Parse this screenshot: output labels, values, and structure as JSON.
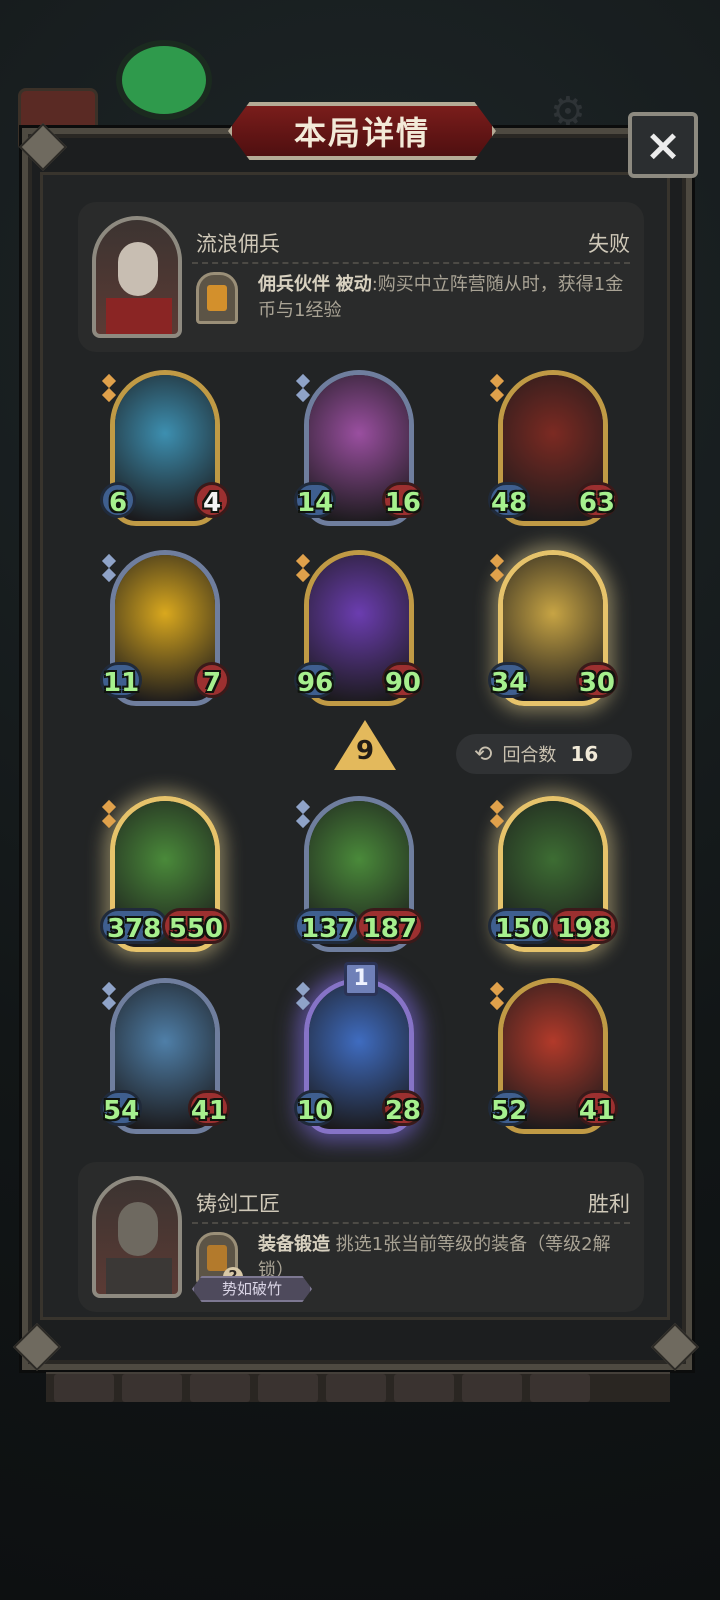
{
  "dialog": {
    "title": "本局详情",
    "close_icon": "×"
  },
  "opponent_top": {
    "name": "流浪佣兵",
    "result": "失败",
    "skill_name": "佣兵伙伴",
    "skill_type": "被动",
    "skill_desc": ":购买中立阵营随从时，获得1金币与1经验"
  },
  "opponent_bottom": {
    "name": "铸剑工匠",
    "result": "胜利",
    "skill_name": "装备锻造",
    "skill_desc": "挑选1张当前等级的装备（等级2解锁）",
    "skill_badge": "2",
    "tag": "势如破竹"
  },
  "rounds": {
    "label": "回合数",
    "value": "16",
    "icon": "refresh-icon"
  },
  "tavern_level": "9",
  "board_top": [
    {
      "atk": "6",
      "hp": "4",
      "frame": "gold",
      "art": "#3d8fb0",
      "hp_white": true
    },
    {
      "atk": "14",
      "hp": "16",
      "frame": "silver",
      "art": "#9a4fa0"
    },
    {
      "atk": "48",
      "hp": "63",
      "frame": "gold",
      "art": "#7c2a22"
    },
    {
      "atk": "11",
      "hp": "7",
      "frame": "silver",
      "art": "#d9a81e"
    },
    {
      "atk": "96",
      "hp": "90",
      "frame": "gold",
      "art": "#6b3db0"
    },
    {
      "atk": "34",
      "hp": "30",
      "frame": "golden",
      "art": "#c7a444"
    }
  ],
  "board_bottom": [
    {
      "atk": "378",
      "hp": "550",
      "frame": "golden",
      "art": "#4a8a3a"
    },
    {
      "atk": "137",
      "hp": "187",
      "frame": "silver",
      "art": "#4a8a3a"
    },
    {
      "atk": "150",
      "hp": "198",
      "frame": "golden",
      "art": "#3d6d33"
    },
    {
      "atk": "54",
      "hp": "41",
      "frame": "silver",
      "art": "#4f7fa8"
    },
    {
      "atk": "10",
      "hp": "28",
      "frame": "purple",
      "art": "#3f6cc0",
      "badge": "1"
    },
    {
      "atk": "52",
      "hp": "41",
      "frame": "gold",
      "art": "#b23a2a"
    }
  ]
}
